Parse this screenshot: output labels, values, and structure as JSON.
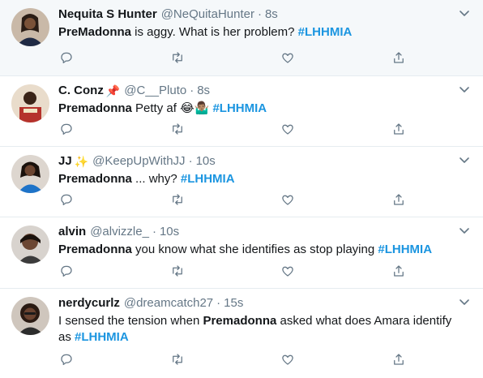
{
  "tweets": [
    {
      "name": "Nequita S Hunter",
      "name_emoji": "",
      "handle": "@NeQuitaHunter",
      "separator": "·",
      "time": "8s",
      "pre_bold": "",
      "bold": "PreMadonna",
      "text": " is aggy. What is her problem? ",
      "emoji": "",
      "hashtag": "#LHHMIA",
      "highlighted": true
    },
    {
      "name": "C. Conz",
      "name_emoji": "📌",
      "handle": "@C__Pluto",
      "separator": "·",
      "time": "8s",
      "pre_bold": "",
      "bold": "Premadonna",
      "text": " Petty af ",
      "emoji": "😂🤷🏽‍♂️ ",
      "hashtag": "#LHHMIA",
      "highlighted": false
    },
    {
      "name": "JJ",
      "name_emoji": "✨",
      "handle": "@KeepUpWithJJ",
      "separator": "·",
      "time": "10s",
      "pre_bold": "",
      "bold": "Premadonna",
      "text": " ... why? ",
      "emoji": "",
      "hashtag": "#LHHMIA",
      "highlighted": false
    },
    {
      "name": "alvin",
      "name_emoji": "",
      "handle": "@alvizzle_",
      "separator": "·",
      "time": "10s",
      "pre_bold": "",
      "bold": "Premadonna",
      "text": " you know what she identifies as stop playing ",
      "emoji": "",
      "hashtag": "#LHHMIA",
      "highlighted": false
    },
    {
      "name": "nerdycurlz",
      "name_emoji": "",
      "handle": "@dreamcatch27",
      "separator": "·",
      "time": "15s",
      "pre_bold": "I sensed the tension when ",
      "bold": "Premadonna",
      "text": " asked what does Amara identify as ",
      "emoji": "",
      "hashtag": "#LHHMIA",
      "highlighted": false
    }
  ],
  "icons": {
    "reply": "reply-icon",
    "retweet": "retweet-icon",
    "like": "heart-icon",
    "share": "share-icon",
    "more": "chevron-down-icon"
  },
  "colors": {
    "hashtag": "#1b95e0",
    "secondary": "#657786",
    "highlight_bg": "#f5f8fa",
    "divider": "#e6ecf0"
  }
}
